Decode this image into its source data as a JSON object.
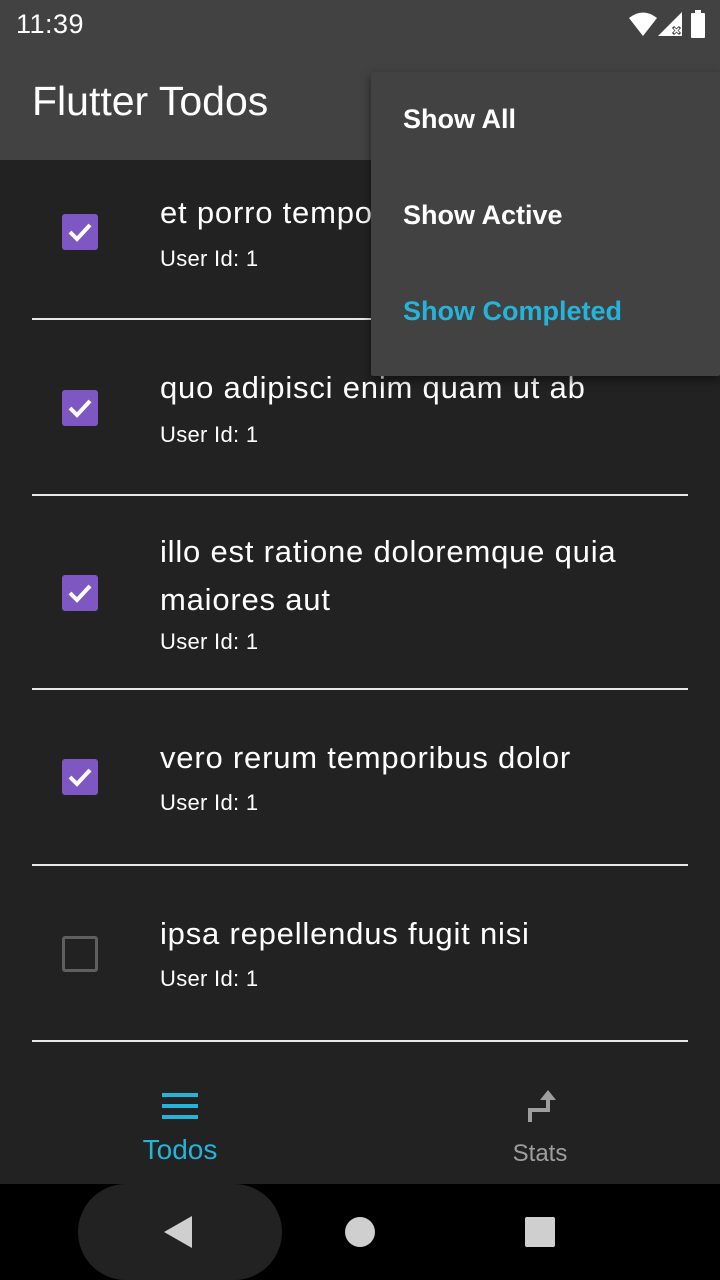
{
  "status_bar": {
    "time": "11:39",
    "icons": [
      "wifi-icon",
      "cell-signal-icon",
      "battery-icon"
    ]
  },
  "app_bar": {
    "title": "Flutter Todos"
  },
  "todos": [
    {
      "title": "et porro tempora",
      "user": "User Id: 1",
      "completed": true
    },
    {
      "title": "quo adipisci enim quam ut ab",
      "user": "User Id: 1",
      "completed": true
    },
    {
      "title": "illo est ratione doloremque quia maiores aut",
      "user": "User Id: 1",
      "completed": true
    },
    {
      "title": "vero rerum temporibus dolor",
      "user": "User Id: 1",
      "completed": true
    },
    {
      "title": "ipsa repellendus fugit nisi",
      "user": "User Id: 1",
      "completed": false
    }
  ],
  "filter_menu": {
    "items": [
      {
        "label": "Show All",
        "selected": false
      },
      {
        "label": "Show Active",
        "selected": false
      },
      {
        "label": "Show Completed",
        "selected": true
      }
    ]
  },
  "bottom_nav": {
    "items": [
      {
        "label": "Todos",
        "icon": "list-icon",
        "active": true
      },
      {
        "label": "Stats",
        "icon": "stats-icon",
        "active": false
      }
    ]
  },
  "system_nav": {
    "icons": [
      "back-icon",
      "home-icon",
      "recents-icon"
    ]
  },
  "colors": {
    "app_bar": "#424242",
    "background": "#222222",
    "accent": "#26b3d9",
    "checkbox": "#7e57c2",
    "inactive": "#9e9e9e"
  }
}
